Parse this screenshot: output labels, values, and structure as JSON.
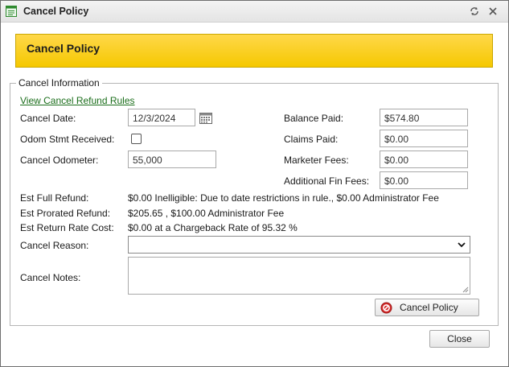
{
  "window": {
    "title": "Cancel Policy"
  },
  "banner": {
    "title": "Cancel Policy"
  },
  "section": {
    "legend": "Cancel Information",
    "refund_rules_link": "View Cancel Refund Rules"
  },
  "fields": {
    "cancel_date_label": "Cancel Date:",
    "cancel_date_value": "12/3/2024",
    "odom_label": "Odom Stmt Received:",
    "odom_checked": false,
    "cancel_odometer_label": "Cancel Odometer:",
    "cancel_odometer_value": "55,000",
    "balance_paid_label": "Balance Paid:",
    "balance_paid_value": "$574.80",
    "claims_paid_label": "Claims Paid:",
    "claims_paid_value": "$0.00",
    "marketer_fees_label": "Marketer Fees:",
    "marketer_fees_value": "$0.00",
    "additional_fin_fees_label": "Additional Fin Fees:",
    "additional_fin_fees_value": "$0.00"
  },
  "estimates": {
    "full_refund_label": "Est Full Refund:",
    "full_refund_value": "$0.00 Inelligible: Due to date restrictions in rule., $0.00 Administrator Fee",
    "prorated_refund_label": "Est Prorated Refund:",
    "prorated_refund_value": "$205.65 , $100.00 Administrator Fee",
    "return_rate_label": "Est Return Rate Cost:",
    "return_rate_value": "$0.00 at a Chargeback Rate of 95.32 %"
  },
  "reason": {
    "label": "Cancel Reason:",
    "selected": ""
  },
  "notes": {
    "label": "Cancel Notes:",
    "value": ""
  },
  "buttons": {
    "cancel_policy": "Cancel Policy",
    "close": "Close"
  },
  "colors": {
    "banner": "#f5c800",
    "link": "#1b6e1b",
    "cancel_icon": "#d62b2b"
  },
  "icons": {
    "app": "form-icon",
    "restore": "restore-icon",
    "close": "close-icon",
    "calendar": "calendar-icon",
    "dropdown": "chevron-down-icon",
    "cancel": "cancel-icon"
  }
}
